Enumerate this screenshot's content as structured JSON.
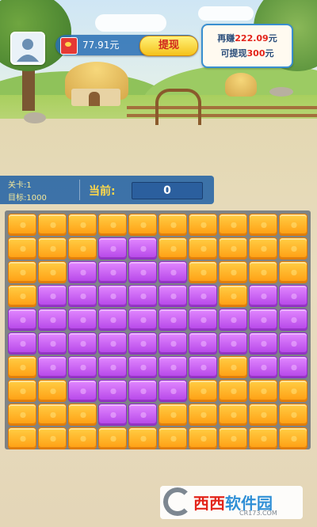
{
  "header": {
    "wallet_amount": "77.91元",
    "withdraw_label": "提现",
    "goal_line1_prefix": "再赚",
    "goal_line1_amount": "222.09",
    "goal_line1_suffix": "元",
    "goal_line2_prefix": "可提现",
    "goal_line2_amount": "300",
    "goal_line2_suffix": "元"
  },
  "info": {
    "level_label": "关卡:1",
    "target_label": "目标:1000",
    "current_label": "当前:",
    "current_score": "0"
  },
  "board": {
    "rows": 10,
    "cols": 10,
    "colors": {
      "o": "#ffb020",
      "p": "#c75cf0"
    },
    "grid": [
      "oooooooooo",
      "oooppooooo",
      "ooppppoooo",
      "oppppppopp",
      "pppppppppp",
      "pppppppppp",
      "oppppppopp",
      "ooppppoooo",
      "oooppooooo",
      "oooooooooo"
    ]
  },
  "watermark": {
    "brand_a": "西西",
    "brand_b": "软件园",
    "url": "CR173.COM"
  }
}
